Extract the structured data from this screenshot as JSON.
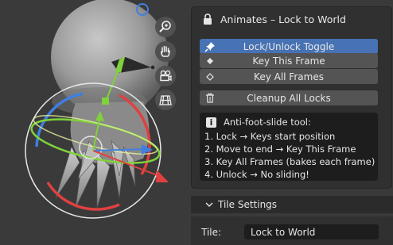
{
  "panel": {
    "title": "Animates – Lock to World",
    "buttons": [
      {
        "label": "Lock/Unlock Toggle",
        "icon": "pin-icon",
        "active": true
      },
      {
        "label": "Key This Frame",
        "icon": "keyframe-filled-icon",
        "active": false
      },
      {
        "label": "Key All Frames",
        "icon": "keyframe-outline-icon",
        "active": false
      }
    ],
    "cleanup_label": "Cleanup All Locks",
    "info": {
      "heading": "Anti-foot-slide tool:",
      "lines": [
        "1. Lock → Keys start position",
        "2. Move to end → Key This Frame",
        "3. Key All Frames (bakes each frame)",
        "4. Unlock → No sliding!"
      ]
    }
  },
  "tile_settings": {
    "header": "Tile Settings",
    "label": "Tile:",
    "value": "Lock to World"
  },
  "viewport": {
    "nav_tools": [
      "zoom-icon",
      "pan-hand-icon",
      "camera-icon",
      "grid-icon"
    ]
  },
  "colors": {
    "accent": "#4772b3",
    "panel_bg": "#303030",
    "viewport_bg": "#3a3a3a",
    "gizmo_red": "#e04040",
    "gizmo_green": "#6fd42a",
    "gizmo_blue": "#3f7fe0"
  }
}
